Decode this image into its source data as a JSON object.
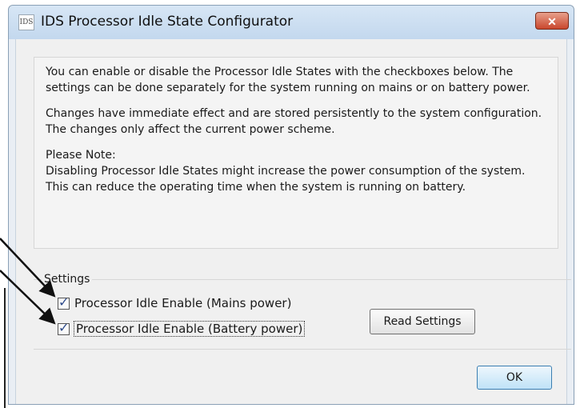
{
  "window": {
    "title": "IDS Processor Idle State Configurator",
    "app_icon_text": "IDS",
    "close_glyph": "✕"
  },
  "info": {
    "paragraph1": "You can enable or disable the Processor Idle States with the checkboxes below. The settings can be done separately for the system running on mains or on battery power.",
    "paragraph2": "Changes have immediate effect and are stored persistently to the system configuration. The changes only affect the current power scheme.",
    "note_heading": "Please Note:",
    "note_body": "Disabling Processor Idle States might increase the power consumption of the system. This can reduce the operating time when the system is running on battery."
  },
  "settings": {
    "group_label": "Settings",
    "mains_label": "Processor Idle Enable (Mains power)",
    "mains_checked": true,
    "battery_label": "Processor Idle Enable (Battery power)",
    "battery_checked": true,
    "check_glyph": "✓",
    "read_button_label": "Read Settings"
  },
  "footer": {
    "ok_label": "OK"
  },
  "icons": {
    "app": "ids-app-icon",
    "close": "close-icon",
    "checkbox": "checkmark-icon",
    "annotation": "arrow-icon"
  },
  "colors": {
    "titlebar": "#c3d8ee",
    "close_button": "#c9472d",
    "ok_button_border": "#3c7fb1"
  }
}
